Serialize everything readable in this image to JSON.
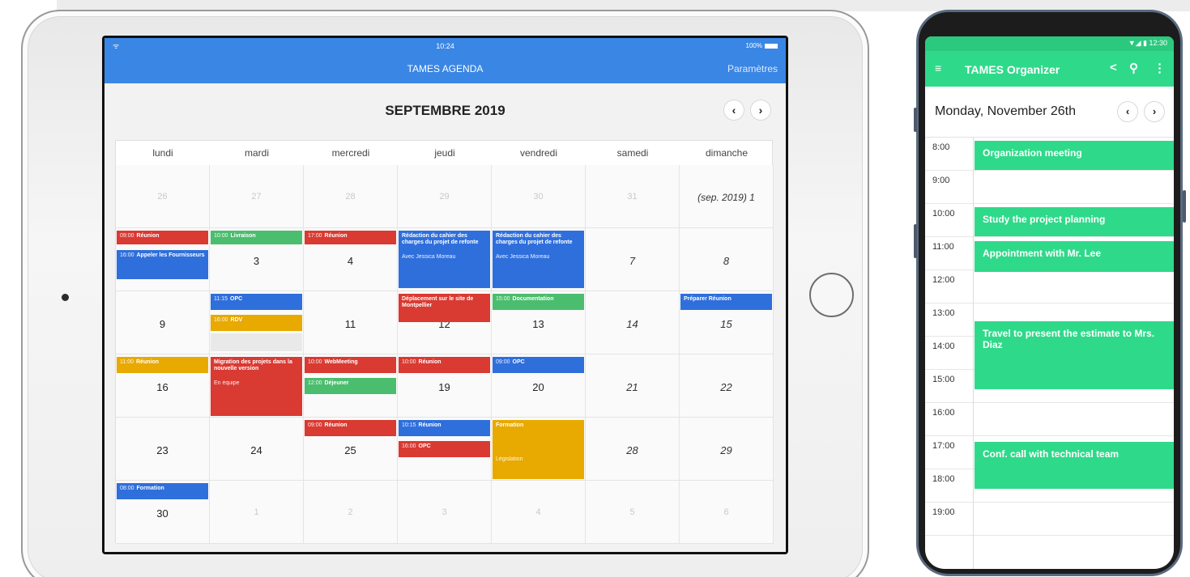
{
  "tablet": {
    "status": {
      "time": "10:24",
      "battery": "100%",
      "wifi": "ᯤ"
    },
    "app_title": "TAMES AGENDA",
    "settings_label": "Paramètres",
    "month_title": "SEPTEMBRE 2019",
    "prev_label": "‹",
    "next_label": "›",
    "weekdays": [
      "lundi",
      "mardi",
      "mercredi",
      "jeudi",
      "vendredi",
      "samedi",
      "dimanche"
    ],
    "weeks": [
      [
        "26",
        "27",
        "28",
        "29",
        "30",
        "31",
        "(sep. 2019) 1"
      ],
      [
        "",
        "3",
        "4",
        "",
        "",
        "7",
        "8"
      ],
      [
        "9",
        "",
        "11",
        "12",
        "13",
        "14",
        "15"
      ],
      [
        "16",
        "",
        "",
        "19",
        "20",
        "21",
        "22"
      ],
      [
        "23",
        "24",
        "25",
        "",
        "",
        "28",
        "29"
      ],
      [
        "30",
        "1",
        "2",
        "3",
        "4",
        "5",
        "6"
      ]
    ],
    "events": {
      "e1": {
        "time": "09:00",
        "title": "Réunion"
      },
      "e2": {
        "time": "16:00",
        "title": "Appeler les Fournisseurs"
      },
      "e3": {
        "time": "10:00",
        "title": "Livraison"
      },
      "e4": {
        "time": "17:00",
        "title": "Réunion"
      },
      "e5": {
        "title": "Rédaction du cahier des charges du projet de refonte",
        "sub": "Avec Jessica Moreau"
      },
      "e6": {
        "title": "Rédaction du cahier des charges du projet de refonte",
        "sub": "Avec Jessica Moreau"
      },
      "e7": {
        "time": "11:15",
        "title": "OPC"
      },
      "e8": {
        "time": "16:00",
        "title": "RDV"
      },
      "e9": {
        "title": "Déplacement sur le site de Montpellier"
      },
      "e10": {
        "time": "15:00",
        "title": "Documentation"
      },
      "e11": {
        "title": "Préparer Réunion"
      },
      "e12": {
        "time": "11:00",
        "title": "Réunion"
      },
      "e13": {
        "title": "Migration des projets dans la nouvelle version",
        "sub": "En équipe"
      },
      "e14": {
        "time": "10:00",
        "title": "WebMeeting"
      },
      "e15": {
        "time": "12:00",
        "title": "Déjeuner"
      },
      "e16": {
        "time": "10:00",
        "title": "Réunion"
      },
      "e17": {
        "time": "09:00",
        "title": "OPC"
      },
      "e18": {
        "time": "09:00",
        "title": "Réunion"
      },
      "e19": {
        "time": "10:15",
        "title": "Réunion"
      },
      "e20": {
        "time": "16:00",
        "title": "OPC"
      },
      "e21": {
        "title": "Formation",
        "sub": "Législation"
      },
      "e22": {
        "time": "08:00",
        "title": "Formation"
      }
    },
    "colors": {
      "red": "#d93a32",
      "blue": "#2f6fdc",
      "green": "#4bbd6e",
      "yellow": "#e8a900",
      "header": "#3a86e4"
    }
  },
  "phone": {
    "status_time": "▼◢ ▮ 12:30",
    "menu_icon": "≡",
    "app_title": "TAMES Organizer",
    "share_icon": "<",
    "search_icon": "⚲",
    "more_icon": "⋮",
    "date_label": "Monday, November 26th",
    "prev_label": "‹",
    "next_label": "›",
    "hours": [
      "8:00",
      "9:00",
      "10:00",
      "11:00",
      "12:00",
      "13:00",
      "14:00",
      "15:00",
      "16:00",
      "17:00",
      "18:00",
      "19:00"
    ],
    "events": [
      "Organization meeting",
      "Study the project planning",
      "Appointment with Mr. Lee",
      "Travel to present the estimate to Mrs. Diaz",
      "Conf. call with technical team"
    ],
    "accent": "#2fd98a"
  }
}
